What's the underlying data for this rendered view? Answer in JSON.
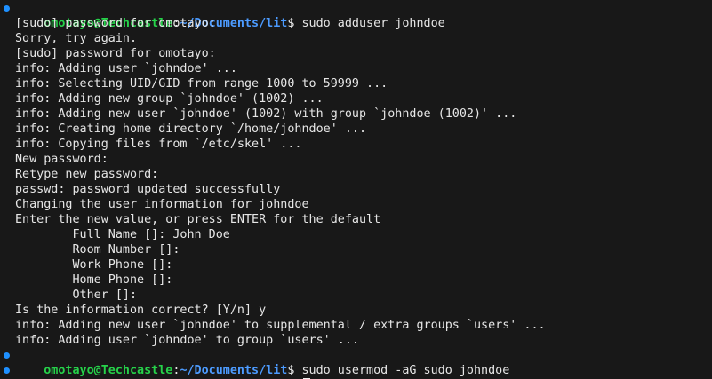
{
  "colors": {
    "background": "#181818",
    "text": "#e6e6e6",
    "prompt_user": "#26d24a",
    "prompt_path": "#4c9bff",
    "marker": "#1e90ff"
  },
  "prompt": {
    "user_host": "omotayo@Techcastle",
    "colon": ":",
    "path": "~/Documents/lit",
    "symbol": "$ "
  },
  "commands": [
    "sudo adduser johndoe",
    "sudo usermod -aG sudo johndoe",
    ""
  ],
  "output": [
    "[sudo] password for omotayo:",
    "Sorry, try again.",
    "[sudo] password for omotayo:",
    "info: Adding user `johndoe' ...",
    "info: Selecting UID/GID from range 1000 to 59999 ...",
    "info: Adding new group `johndoe' (1002) ...",
    "info: Adding new user `johndoe' (1002) with group `johndoe (1002)' ...",
    "info: Creating home directory `/home/johndoe' ...",
    "info: Copying files from `/etc/skel' ...",
    "New password:",
    "Retype new password:",
    "passwd: password updated successfully",
    "Changing the user information for johndoe",
    "Enter the new value, or press ENTER for the default",
    "        Full Name []: John Doe",
    "        Room Number []:",
    "        Work Phone []:",
    "        Home Phone []:",
    "        Other []:",
    "Is the information correct? [Y/n] y",
    "info: Adding new user `johndoe' to supplemental / extra groups `users' ...",
    "info: Adding user `johndoe' to group `users' ..."
  ]
}
